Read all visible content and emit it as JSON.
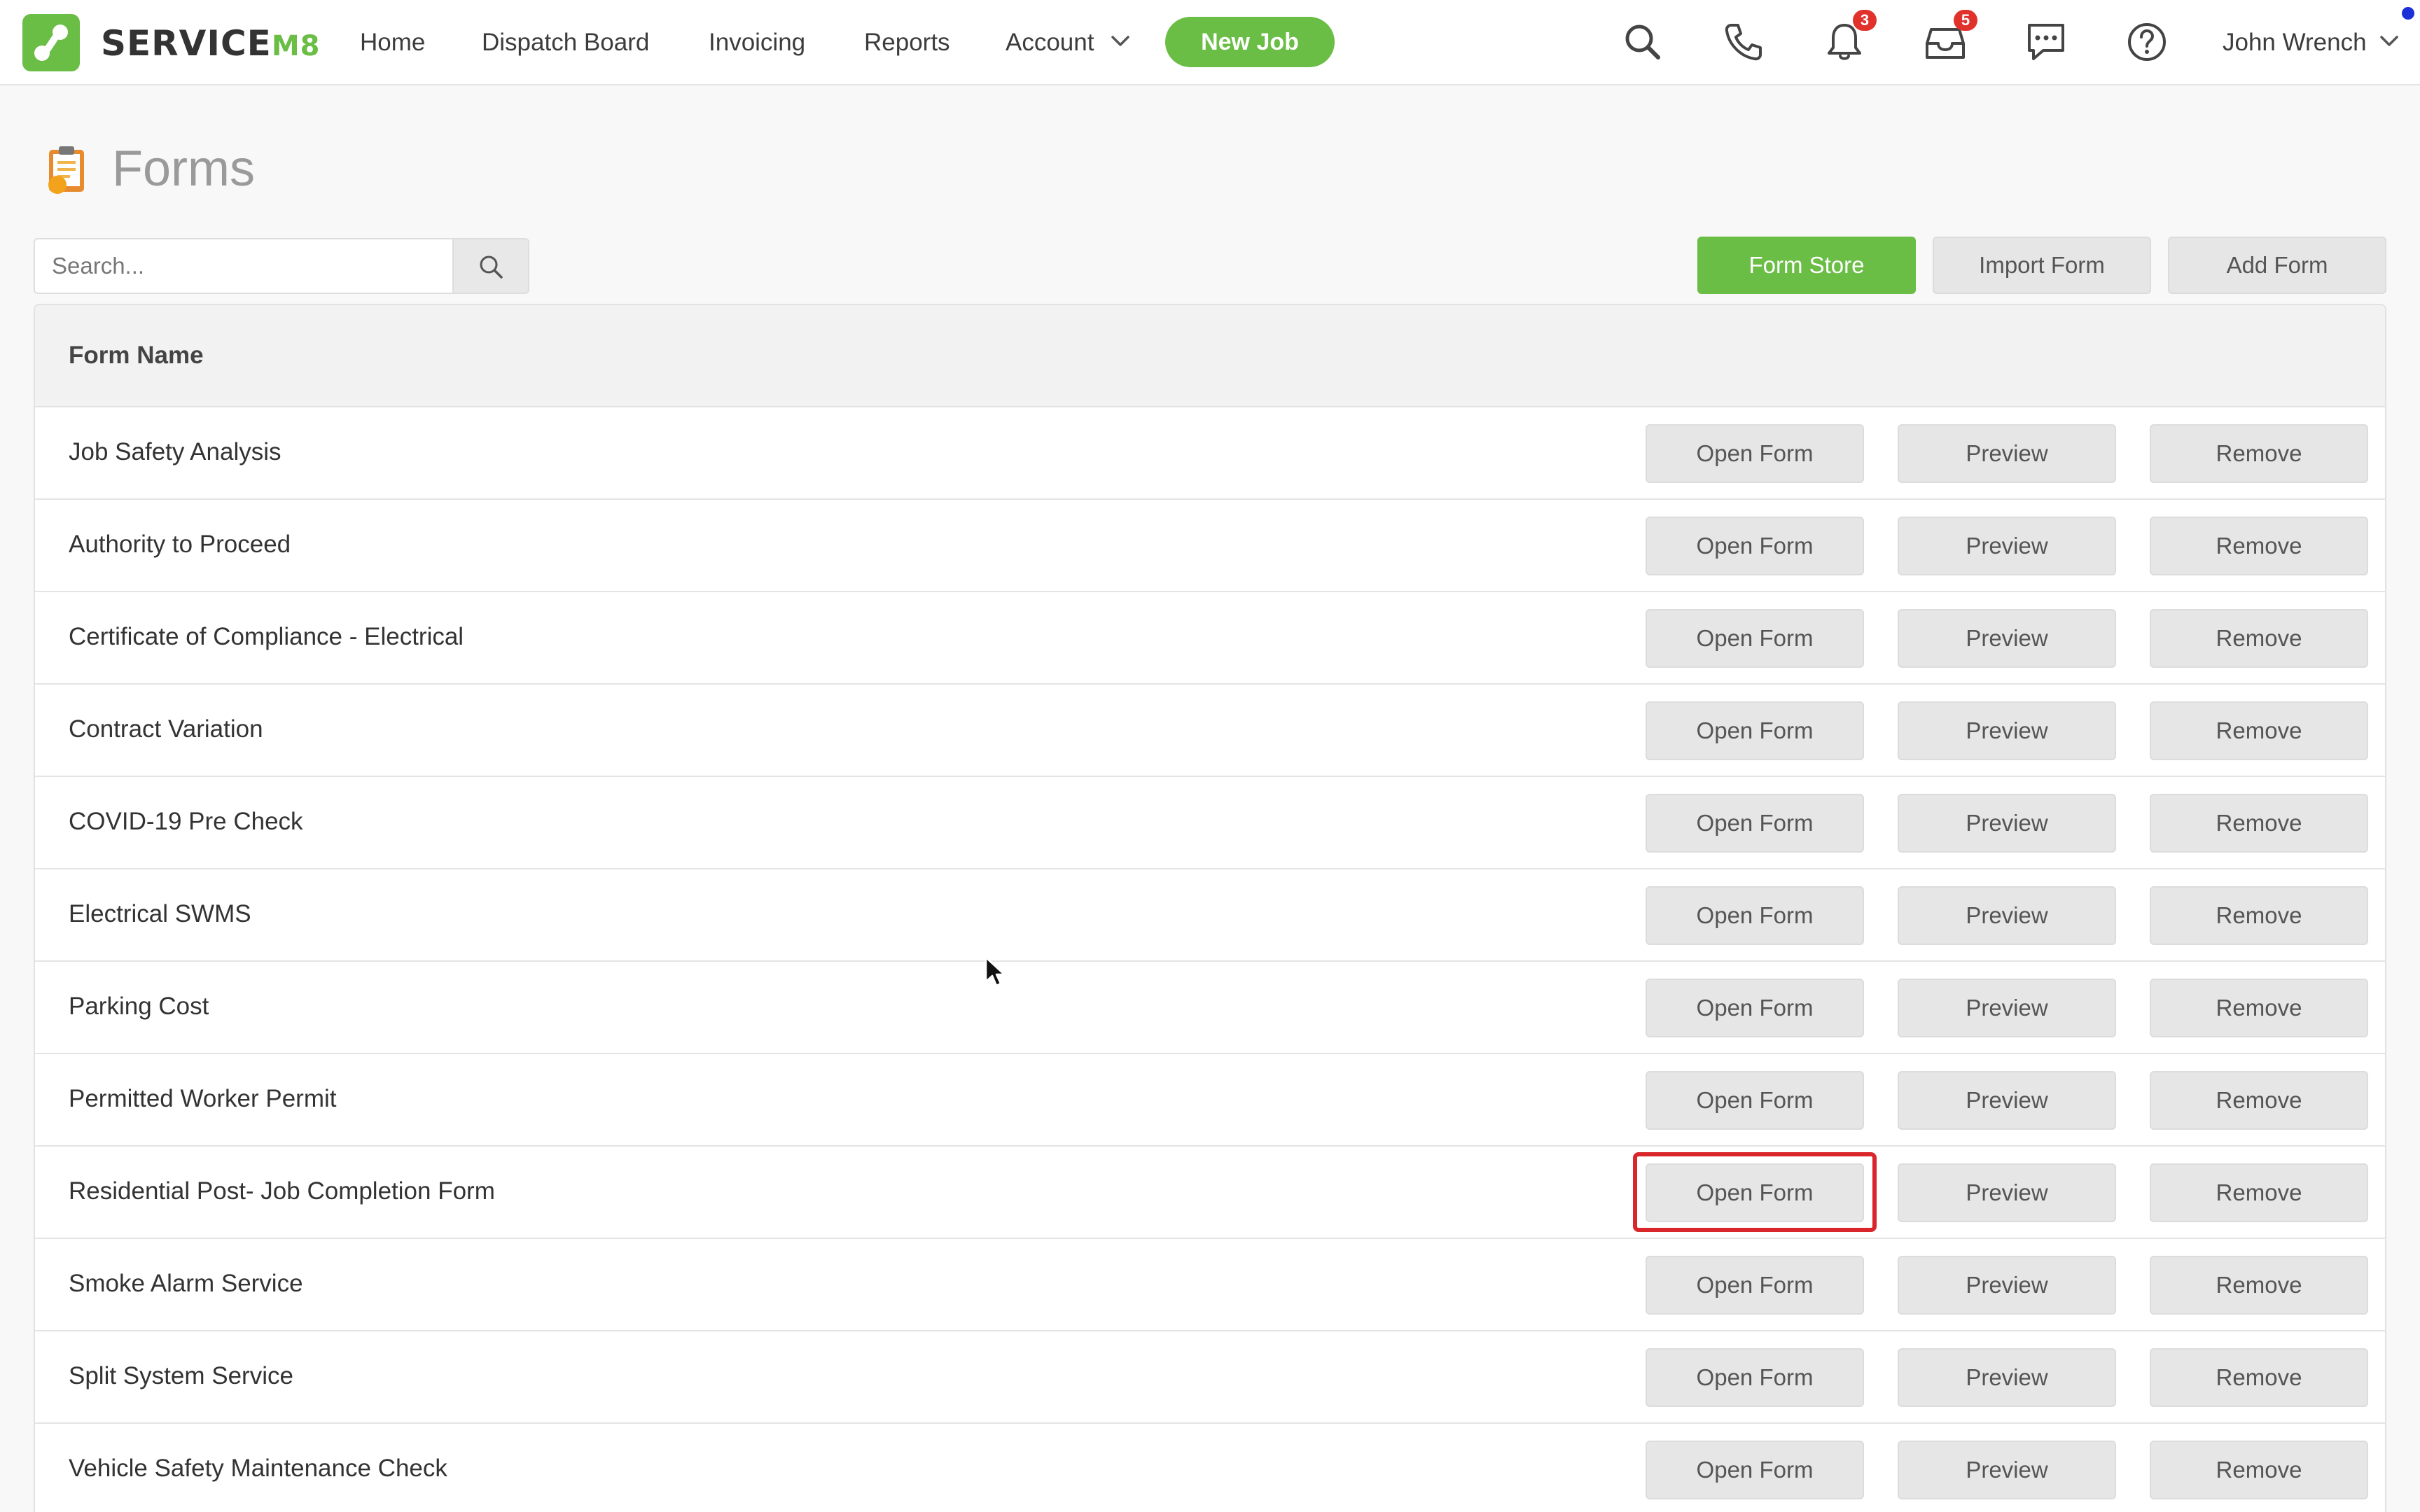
{
  "brand": {
    "name": "SERVICE",
    "suffix": "M8",
    "accent": "#6abd45"
  },
  "nav": {
    "links": [
      "Home",
      "Dispatch Board",
      "Invoicing",
      "Reports",
      "Account"
    ],
    "new_job": "New Job"
  },
  "toolbar": {
    "icons": [
      "search-icon",
      "phone-icon",
      "bell-icon",
      "inbox-icon",
      "chat-icon",
      "help-icon"
    ],
    "notifications_count": "3",
    "inbox_count": "5",
    "user": "John Wrench"
  },
  "page": {
    "title": "Forms",
    "icon": "clipboard-icon"
  },
  "search": {
    "placeholder": "Search...",
    "value": ""
  },
  "actions": {
    "form_store": "Form Store",
    "import_form": "Import Form",
    "add_form": "Add Form"
  },
  "table": {
    "header": "Form Name",
    "button_labels": {
      "open": "Open Form",
      "preview": "Preview",
      "remove": "Remove"
    },
    "rows": [
      "Job Safety Analysis",
      "Authority to Proceed",
      "Certificate of Compliance - Electrical",
      "Contract Variation",
      "COVID-19 Pre Check",
      "Electrical SWMS",
      "Parking Cost",
      "Permitted Worker Permit",
      "Residential Post- Job Completion Form",
      "Smoke Alarm Service",
      "Split System Service",
      "Vehicle Safety Maintenance Check"
    ],
    "highlighted_row": 8
  },
  "colors": {
    "badge": "#e0312b",
    "highlight": "#d9262b",
    "title_grey": "#9a9a9a"
  }
}
